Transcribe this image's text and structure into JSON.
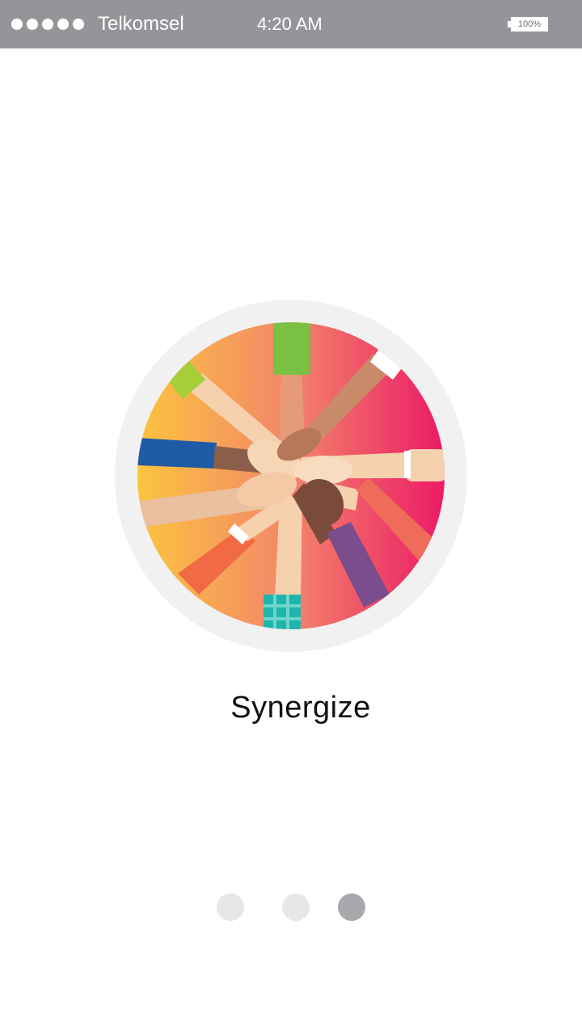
{
  "status_bar": {
    "carrier": "Telkomsel",
    "time": "4:20 AM",
    "battery": "100%",
    "signal_bars": 5
  },
  "onboarding": {
    "illustration_icon": "team-hands-icon",
    "title": "Synergize",
    "pages": 3,
    "current_page": 3
  },
  "colors": {
    "status_bar_bg": "#939598",
    "gradient_start": "#fbc43f",
    "gradient_mid": "#f3856a",
    "gradient_end": "#ec1a67",
    "ring": "#f1f1f2",
    "pager_inactive": "#e6e7e8",
    "pager_active": "#a7a9ac"
  }
}
